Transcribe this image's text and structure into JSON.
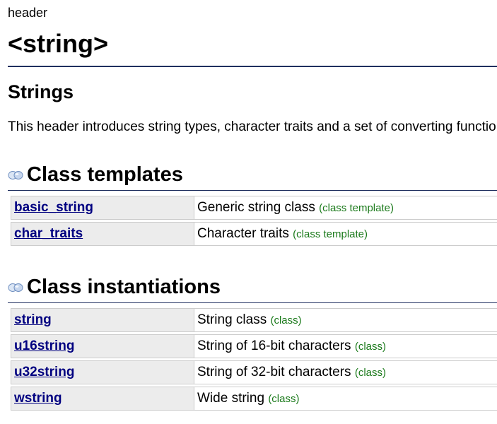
{
  "header_kind": "header",
  "title": "<string>",
  "subtitle": "Strings",
  "description": "This header introduces string types, character traits and a set of converting functions:",
  "sections": [
    {
      "title": "Class templates",
      "icon": "class-group-icon",
      "rows": [
        {
          "name": "basic_string",
          "desc": "Generic string class",
          "badge": "(class template)"
        },
        {
          "name": "char_traits",
          "desc": "Character traits",
          "badge": "(class template)"
        }
      ]
    },
    {
      "title": "Class instantiations",
      "icon": "class-group-icon",
      "rows": [
        {
          "name": "string",
          "desc": "String class",
          "badge": "(class)"
        },
        {
          "name": "u16string",
          "desc": "String of 16-bit characters",
          "badge": "(class)"
        },
        {
          "name": "u32string",
          "desc": "String of 32-bit characters",
          "badge": "(class)"
        },
        {
          "name": "wstring",
          "desc": "Wide string",
          "badge": "(class)"
        }
      ]
    }
  ],
  "colors": {
    "link": "#000080",
    "badge": "#1b7a1b",
    "rule": "#1f2f5f",
    "name_cell_bg": "#ececec",
    "border": "#cccccc"
  }
}
